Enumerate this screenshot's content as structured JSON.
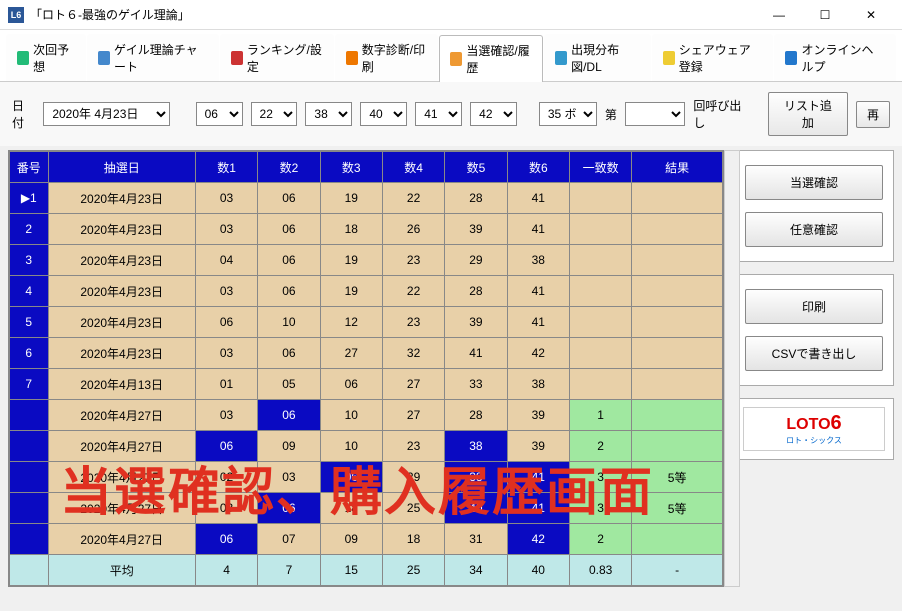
{
  "window": {
    "title": "「ロト６-最強のゲイル理論」"
  },
  "tabs": [
    {
      "label": "次回予想",
      "color": "#2b7"
    },
    {
      "label": "ゲイル理論チャート",
      "color": "#48c"
    },
    {
      "label": "ランキング/設定",
      "color": "#c33"
    },
    {
      "label": "数字診断/印刷",
      "color": "#e70"
    },
    {
      "label": "当選確認/履歴",
      "color": "#e93",
      "active": true
    },
    {
      "label": "出現分布図/DL",
      "color": "#39c"
    },
    {
      "label": "シェアウェア登録",
      "color": "#ec3"
    },
    {
      "label": "オンラインヘルプ",
      "color": "#27c"
    }
  ],
  "toolbar": {
    "date_lbl": "日付",
    "date": "2020年 4月23日",
    "n1": "06",
    "n2": "22",
    "n3": "38",
    "n4": "40",
    "n5": "41",
    "n6": "42",
    "bonus": "35 ボ",
    "kai_lbl": "第",
    "kai_suf": "回呼び出し",
    "list_add": "リスト追加",
    "redo": "再"
  },
  "headers": [
    "番号",
    "抽選日",
    "数1",
    "数2",
    "数3",
    "数4",
    "数5",
    "数6",
    "一致数",
    "結果"
  ],
  "rows": [
    {
      "no": "1",
      "mark": "▶",
      "date": "2020年4月23日",
      "n": [
        "03",
        "06",
        "19",
        "22",
        "28",
        "41"
      ],
      "m": "",
      "r": ""
    },
    {
      "no": "2",
      "date": "2020年4月23日",
      "n": [
        "03",
        "06",
        "18",
        "26",
        "39",
        "41"
      ],
      "m": "",
      "r": ""
    },
    {
      "no": "3",
      "date": "2020年4月23日",
      "n": [
        "04",
        "06",
        "19",
        "23",
        "29",
        "38"
      ],
      "m": "",
      "r": ""
    },
    {
      "no": "4",
      "date": "2020年4月23日",
      "n": [
        "03",
        "06",
        "19",
        "22",
        "28",
        "41"
      ],
      "m": "",
      "r": ""
    },
    {
      "no": "5",
      "date": "2020年4月23日",
      "n": [
        "06",
        "10",
        "12",
        "23",
        "39",
        "41"
      ],
      "m": "",
      "r": ""
    },
    {
      "no": "6",
      "date": "2020年4月23日",
      "n": [
        "03",
        "06",
        "27",
        "32",
        "41",
        "42"
      ],
      "m": "",
      "r": ""
    },
    {
      "no": "7",
      "date": "2020年4月13日",
      "n": [
        "01",
        "05",
        "06",
        "27",
        "33",
        "38"
      ],
      "m": "",
      "r": ""
    },
    {
      "no": "",
      "date": "2020年4月27日",
      "n": [
        "03",
        "06",
        "10",
        "27",
        "28",
        "39"
      ],
      "hl": [
        0,
        1,
        0,
        0,
        0,
        0
      ],
      "m": "1",
      "mg": true,
      "r": "",
      "rg": true
    },
    {
      "no": "",
      "date": "2020年4月27日",
      "n": [
        "06",
        "09",
        "10",
        "23",
        "38",
        "39"
      ],
      "hl": [
        1,
        0,
        0,
        0,
        1,
        0
      ],
      "m": "2",
      "mg": true,
      "r": "",
      "rg": true
    },
    {
      "no": "",
      "date": "2020年4月27日",
      "n": [
        "02",
        "03",
        "06",
        "29",
        "38",
        "41"
      ],
      "hl": [
        0,
        0,
        1,
        0,
        1,
        1
      ],
      "m": "3",
      "mg": true,
      "r": "5等",
      "rg": true
    },
    {
      "no": "",
      "date": "2020年4月27日",
      "n": [
        "03",
        "06",
        "18",
        "25",
        "40",
        "41"
      ],
      "hl": [
        0,
        1,
        0,
        0,
        1,
        1
      ],
      "m": "3",
      "mg": true,
      "r": "5等",
      "rg": true
    },
    {
      "no": "",
      "date": "2020年4月27日",
      "n": [
        "06",
        "07",
        "09",
        "18",
        "31",
        "42"
      ],
      "hl": [
        1,
        0,
        0,
        0,
        0,
        1
      ],
      "m": "2",
      "mg": true,
      "r": "",
      "rg": true
    }
  ],
  "avg": {
    "label": "平均",
    "n": [
      "4",
      "7",
      "15",
      "25",
      "34",
      "40"
    ],
    "m": "0.83",
    "r": "-"
  },
  "side": {
    "b1": "当選確認",
    "b2": "任意確認",
    "b3": "印刷",
    "b4": "CSVで書き出し"
  },
  "logo": {
    "t1": "LOTO",
    "t2": "6",
    "t3": "ロト・シックス"
  },
  "overlay": "当選確認、購入履歴画面"
}
